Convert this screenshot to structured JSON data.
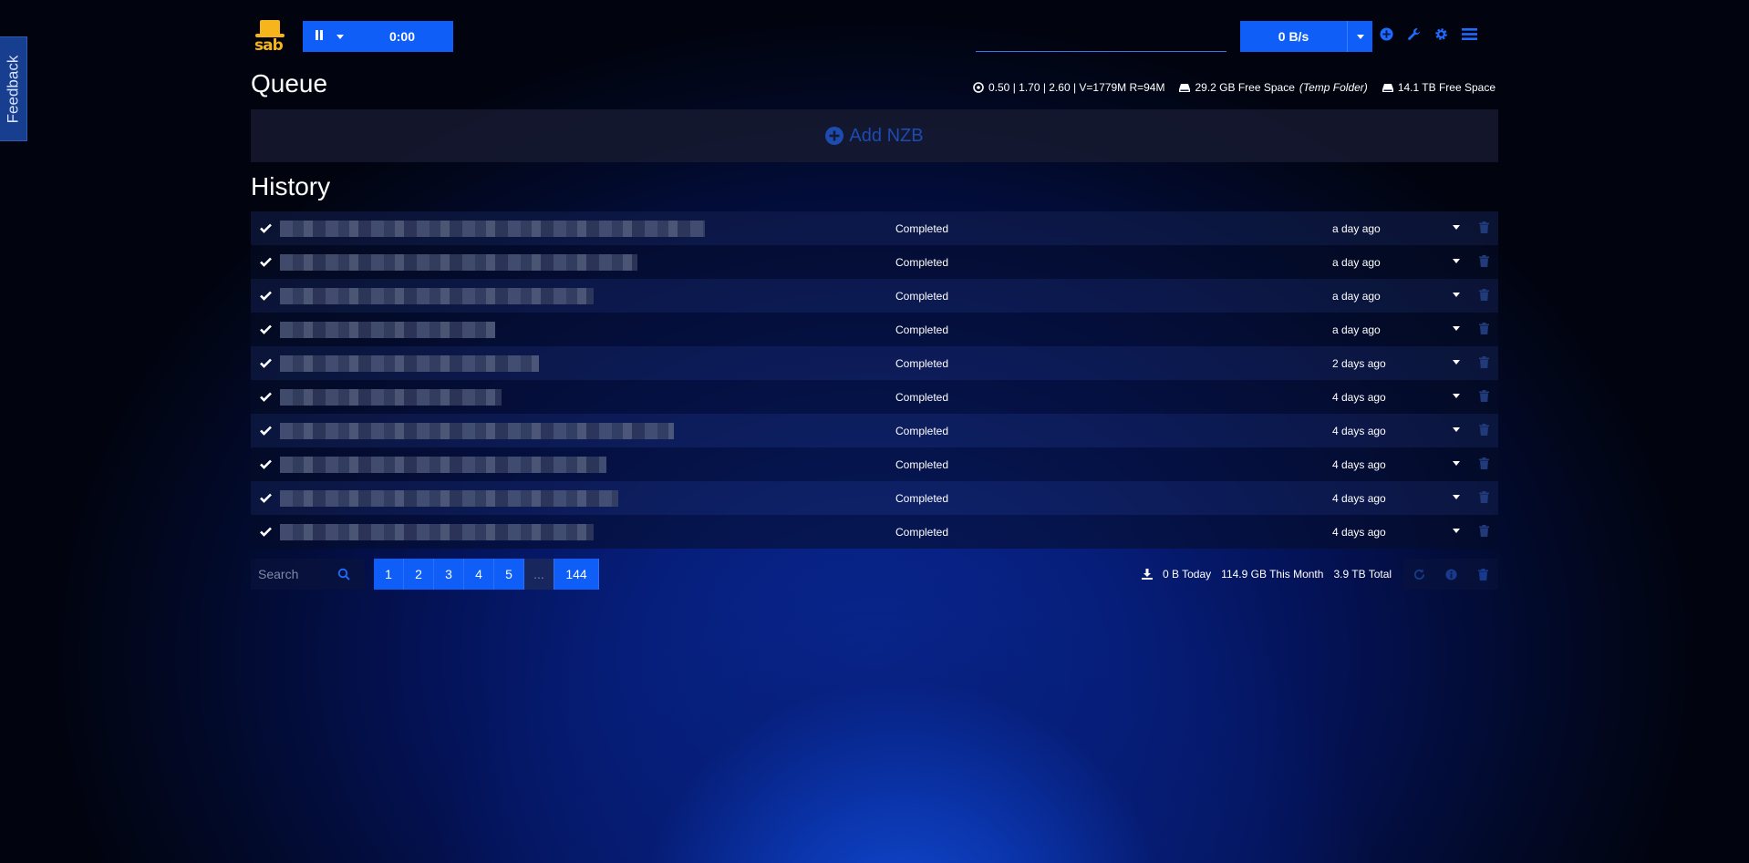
{
  "feedback": {
    "label": "Feedback"
  },
  "topbar": {
    "timer": "0:00",
    "speed": "0 B/s",
    "speed_limit_value": ""
  },
  "queue": {
    "title": "Queue",
    "stats": {
      "load": "0.50 | 1.70 | 2.60 | V=1779M R=94M",
      "temp_free": "29.2 GB Free Space",
      "temp_label": "(Temp Folder)",
      "complete_free": "14.1 TB Free Space"
    },
    "add_nzb": "Add NZB"
  },
  "history": {
    "title": "History",
    "rows": [
      {
        "status": "Completed",
        "when": "a day ago",
        "name_fraction": 0.69
      },
      {
        "status": "Completed",
        "when": "a day ago",
        "name_fraction": 0.58
      },
      {
        "status": "Completed",
        "when": "a day ago",
        "name_fraction": 0.51
      },
      {
        "status": "Completed",
        "when": "a day ago",
        "name_fraction": 0.35
      },
      {
        "status": "Completed",
        "when": "2 days ago",
        "name_fraction": 0.42
      },
      {
        "status": "Completed",
        "when": "4 days ago",
        "name_fraction": 0.36
      },
      {
        "status": "Completed",
        "when": "4 days ago",
        "name_fraction": 0.64
      },
      {
        "status": "Completed",
        "when": "4 days ago",
        "name_fraction": 0.53
      },
      {
        "status": "Completed",
        "when": "4 days ago",
        "name_fraction": 0.55
      },
      {
        "status": "Completed",
        "when": "4 days ago",
        "name_fraction": 0.51
      }
    ]
  },
  "footer": {
    "search_placeholder": "Search",
    "pages": [
      "1",
      "2",
      "3",
      "4",
      "5",
      "...",
      "144"
    ],
    "today": "0 B Today",
    "month": "114.9 GB This Month",
    "total": "3.9 TB Total"
  },
  "colors": {
    "accent": "#0e5ef7",
    "logo": "#f7b51c"
  }
}
